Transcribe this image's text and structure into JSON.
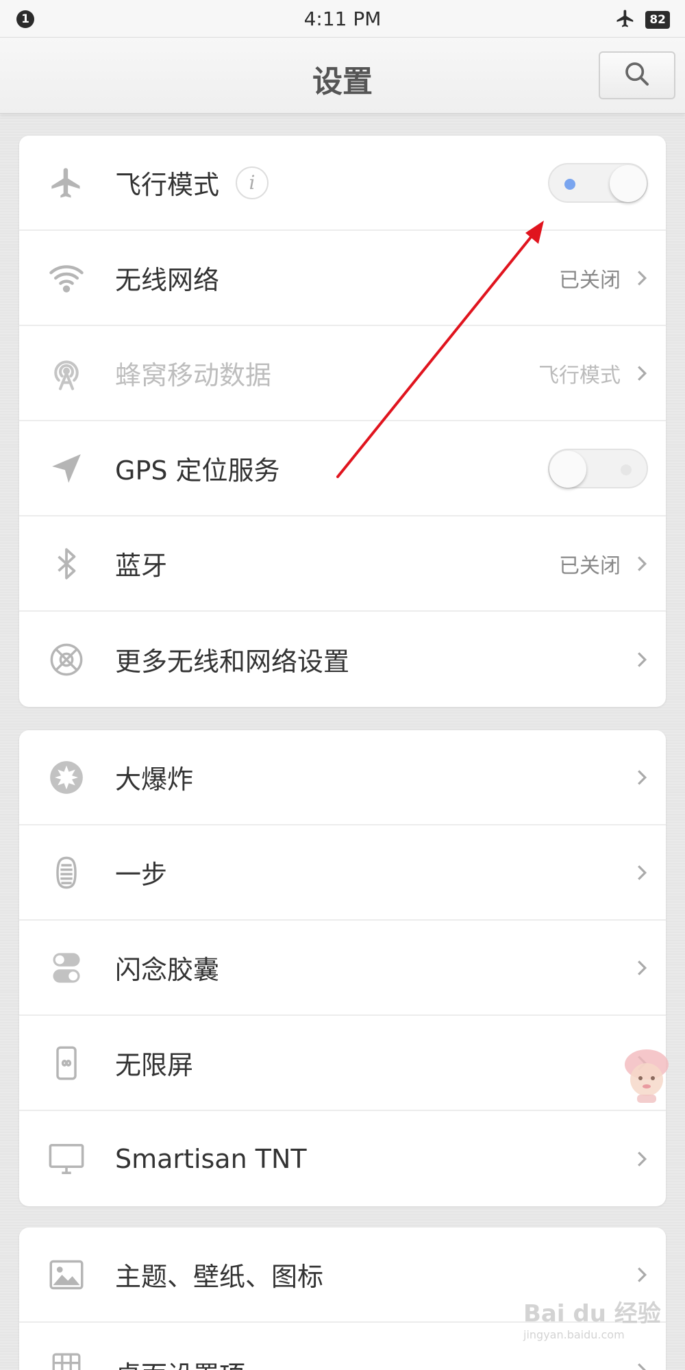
{
  "status_bar": {
    "notification_count": "1",
    "time": "4:11 PM",
    "battery": "82"
  },
  "header": {
    "title": "设置"
  },
  "section_network": [
    {
      "label": "飞行模式",
      "icon": "airplane-icon",
      "control": "toggle",
      "state": "on"
    },
    {
      "label": "无线网络",
      "icon": "wifi-icon",
      "value": "已关闭"
    },
    {
      "label": "蜂窝移动数据",
      "icon": "cellular-tower-icon",
      "value": "飞行模式",
      "disabled": true
    },
    {
      "label": "GPS 定位服务",
      "icon": "location-arrow-icon",
      "control": "toggle",
      "state": "off"
    },
    {
      "label": "蓝牙",
      "icon": "bluetooth-icon",
      "value": "已关闭"
    },
    {
      "label": "更多无线和网络设置",
      "icon": "globe-network-icon"
    }
  ],
  "section_features": [
    {
      "label": "大爆炸",
      "icon": "big-bang-icon"
    },
    {
      "label": "一步",
      "icon": "one-step-icon"
    },
    {
      "label": "闪念胶囊",
      "icon": "idea-capsule-icon"
    },
    {
      "label": "无限屏",
      "icon": "infinite-screen-icon"
    },
    {
      "label": "Smartisan TNT",
      "icon": "monitor-icon"
    }
  ],
  "section_appearance": [
    {
      "label": "主题、壁纸、图标",
      "icon": "image-icon"
    },
    {
      "label": "桌面设置项",
      "icon": "grid-icon"
    }
  ],
  "watermark": {
    "text": "Bai du 经验",
    "sub": "jingyan.baidu.com"
  },
  "colors": {
    "annotation_arrow": "#e0141e",
    "toggle_on_dot": "#7aa5ef",
    "icon_gray": "#b5b5b5"
  }
}
